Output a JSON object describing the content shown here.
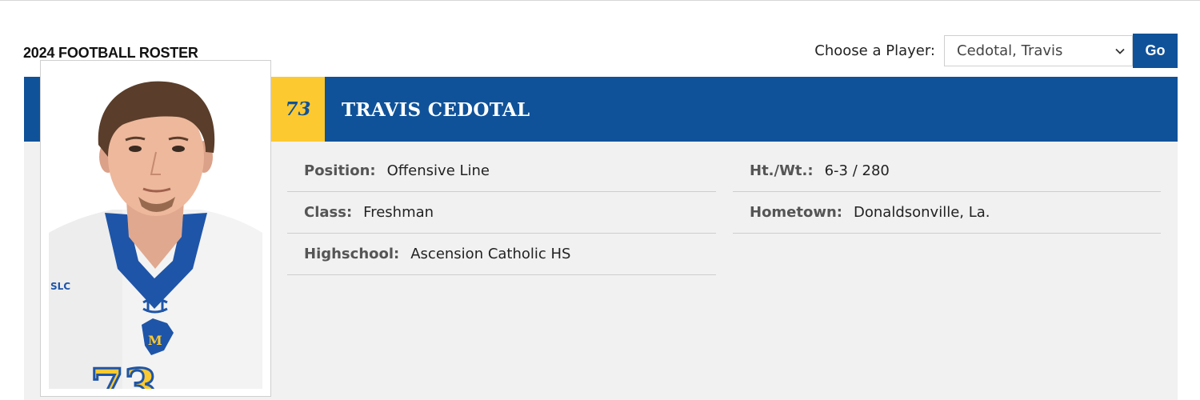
{
  "roster_title": "2024 FOOTBALL ROSTER",
  "chooser": {
    "label": "Choose a Player:",
    "selected": "Cedotal, Travis",
    "go_label": "Go"
  },
  "player": {
    "number": "73",
    "name": "TRAVIS CEDOTAL"
  },
  "details_left": [
    {
      "label": "Position:",
      "value": "Offensive Line"
    },
    {
      "label": "Class:",
      "value": "Freshman"
    },
    {
      "label": "Highschool:",
      "value": "Ascension Catholic HS"
    }
  ],
  "details_right": [
    {
      "label": "Ht./Wt.:",
      "value": "6-3 / 280"
    },
    {
      "label": "Hometown:",
      "value": "Donaldsonville, La."
    }
  ],
  "photo": {
    "jersey_number": "73",
    "jersey_logo_letter": "M",
    "sponsor_text": "SLC"
  },
  "colors": {
    "brand_blue": "#0f5299",
    "brand_gold": "#fcc930",
    "panel_bg": "#f1f1f1"
  },
  "icons": {
    "select": "chevron-down-icon"
  }
}
